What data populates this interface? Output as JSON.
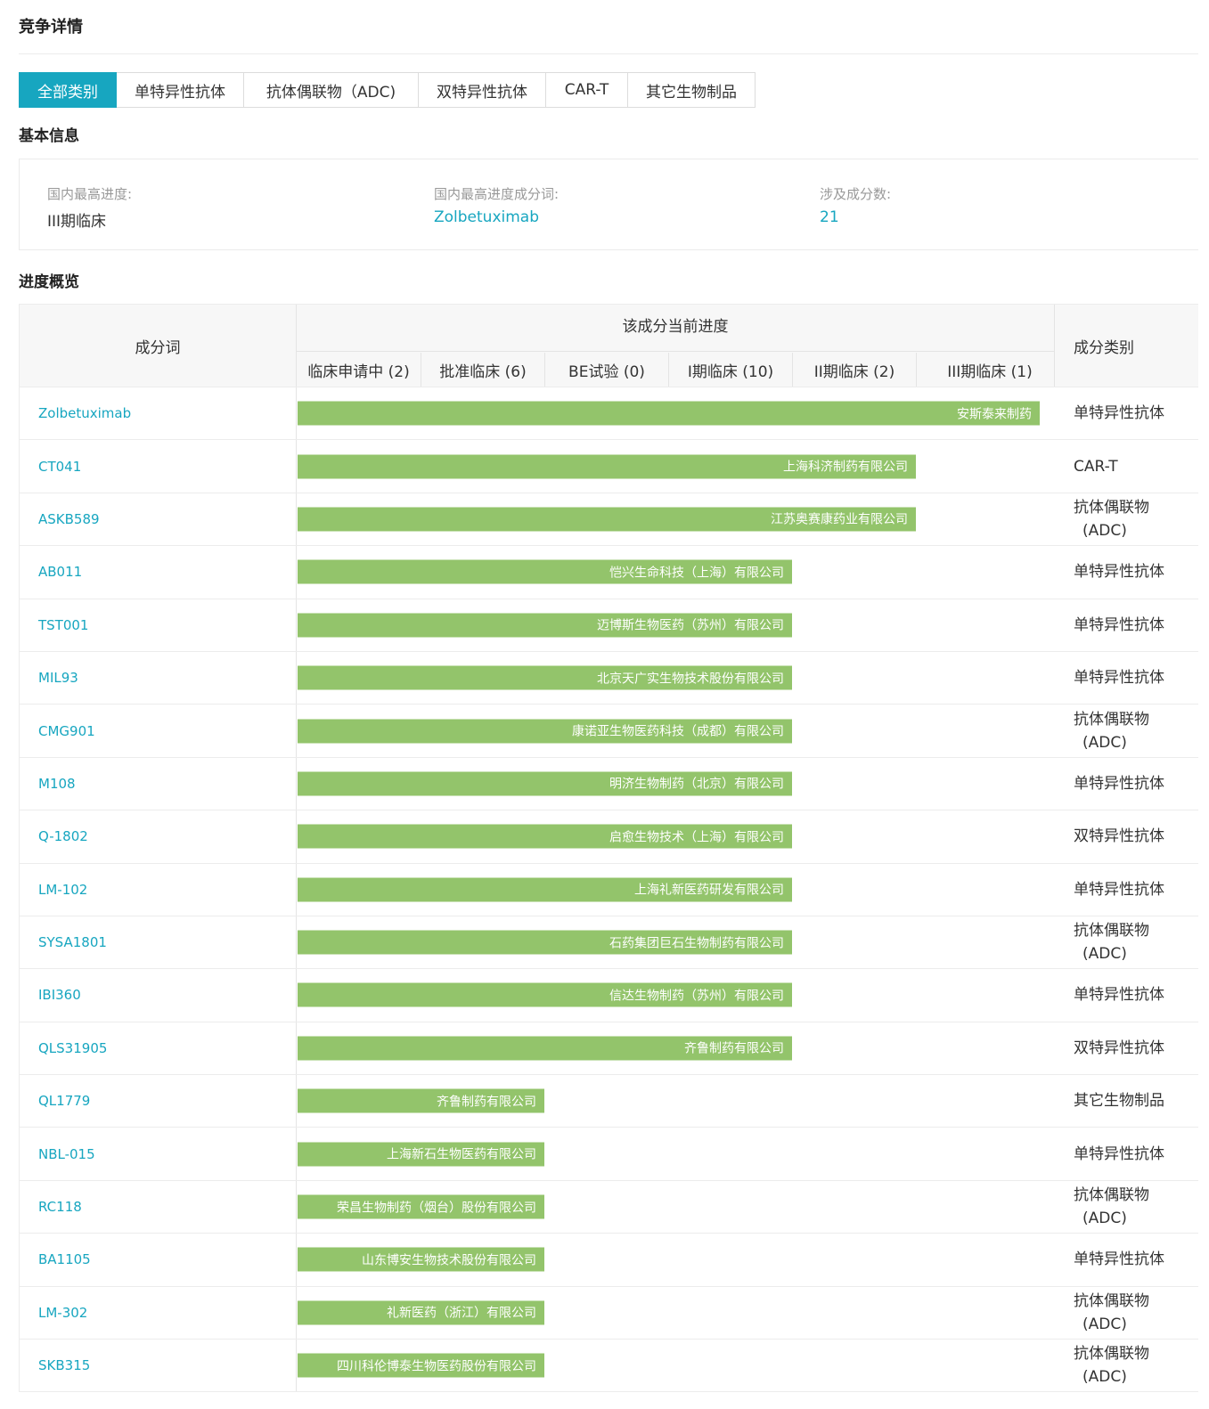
{
  "page_title": "竞争详情",
  "tabs": [
    {
      "label": "全部类别",
      "active": true
    },
    {
      "label": "单特异性抗体"
    },
    {
      "label": "抗体偶联物（ADC)"
    },
    {
      "label": "双特异性抗体"
    },
    {
      "label": "CAR-T"
    },
    {
      "label": "其它生物制品"
    }
  ],
  "basic_info": {
    "title": "基本信息",
    "items": [
      {
        "label": "国内最高进度:",
        "value": "III期临床"
      },
      {
        "label": "国内最高进度成分词:",
        "value": "Zolbetuximab"
      },
      {
        "label": "涉及成分数:",
        "value": "21"
      }
    ]
  },
  "progress": {
    "title": "进度概览",
    "col_ingredient": "成分词",
    "col_progress": "该成分当前进度",
    "col_category": "成分类别",
    "stages": [
      "临床申请中 (2)",
      "批准临床 (6)",
      "BE试验 (0)",
      "I期临床 (10)",
      "II期临床 (2)",
      "III期临床 (1)"
    ],
    "rows": [
      {
        "name": "Zolbetuximab",
        "company": "安斯泰来制药",
        "stage_index": 5,
        "category": "单特异性抗体"
      },
      {
        "name": "CT041",
        "company": "上海科济制药有限公司",
        "stage_index": 4,
        "category": "CAR-T"
      },
      {
        "name": "ASKB589",
        "company": "江苏奥赛康药业有限公司",
        "stage_index": 4,
        "category": "抗体偶联物（ADC)"
      },
      {
        "name": "AB011",
        "company": "恺兴生命科技（上海）有限公司",
        "stage_index": 3,
        "category": "单特异性抗体"
      },
      {
        "name": "TST001",
        "company": "迈博斯生物医药（苏州）有限公司",
        "stage_index": 3,
        "category": "单特异性抗体"
      },
      {
        "name": "MIL93",
        "company": "北京天广实生物技术股份有限公司",
        "stage_index": 3,
        "category": "单特异性抗体"
      },
      {
        "name": "CMG901",
        "company": "康诺亚生物医药科技（成都）有限公司",
        "stage_index": 3,
        "category": "抗体偶联物（ADC)"
      },
      {
        "name": "M108",
        "company": "明济生物制药（北京）有限公司",
        "stage_index": 3,
        "category": "单特异性抗体"
      },
      {
        "name": "Q-1802",
        "company": "启愈生物技术（上海）有限公司",
        "stage_index": 3,
        "category": "双特异性抗体"
      },
      {
        "name": "LM-102",
        "company": "上海礼新医药研发有限公司",
        "stage_index": 3,
        "category": "单特异性抗体"
      },
      {
        "name": "SYSA1801",
        "company": "石药集团巨石生物制药有限公司",
        "stage_index": 3,
        "category": "抗体偶联物（ADC)"
      },
      {
        "name": "IBI360",
        "company": "信达生物制药（苏州）有限公司",
        "stage_index": 3,
        "category": "单特异性抗体"
      },
      {
        "name": "QLS31905",
        "company": "齐鲁制药有限公司",
        "stage_index": 3,
        "category": "双特异性抗体"
      },
      {
        "name": "QL1779",
        "company": "齐鲁制药有限公司",
        "stage_index": 1,
        "category": "其它生物制品"
      },
      {
        "name": "NBL-015",
        "company": "上海新石生物医药有限公司",
        "stage_index": 1,
        "category": "单特异性抗体"
      },
      {
        "name": "RC118",
        "company": "荣昌生物制药（烟台）股份有限公司",
        "stage_index": 1,
        "category": "抗体偶联物（ADC)"
      },
      {
        "name": "BA1105",
        "company": "山东博安生物技术股份有限公司",
        "stage_index": 1,
        "category": "单特异性抗体"
      },
      {
        "name": "LM-302",
        "company": "礼新医药（浙江）有限公司",
        "stage_index": 1,
        "category": "抗体偶联物（ADC)"
      },
      {
        "name": "SKB315",
        "company": "四川科伦博泰生物医药股份有限公司",
        "stage_index": 1,
        "category": "抗体偶联物（ADC)"
      }
    ]
  },
  "colors": {
    "accent": "#17a6c0",
    "bar": "#93c46b"
  }
}
